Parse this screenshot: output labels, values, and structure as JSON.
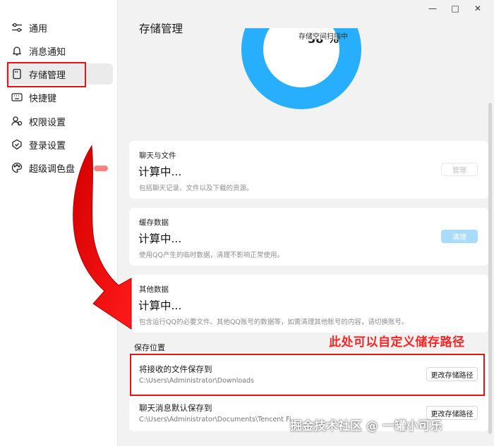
{
  "sidebar": {
    "items": [
      {
        "label": "通用",
        "icon": "sliders-icon"
      },
      {
        "label": "消息通知",
        "icon": "bell-icon"
      },
      {
        "label": "存储管理",
        "icon": "storage-icon",
        "active": true
      },
      {
        "label": "快捷键",
        "icon": "keyboard-icon"
      },
      {
        "label": "权限设置",
        "icon": "users-icon"
      },
      {
        "label": "登录设置",
        "icon": "shield-icon"
      },
      {
        "label": "超级调色盘",
        "icon": "palette-icon"
      }
    ]
  },
  "window": {
    "minimize": "—",
    "maximize": "□",
    "close": "✕"
  },
  "header": {
    "title": "存储管理"
  },
  "scan": {
    "percent": "38 %",
    "label": "存储空间扫描中",
    "ring_color": "#27aefc"
  },
  "cards": [
    {
      "label": "聊天与文件",
      "value": "计算中...",
      "desc": "包括聊天记录、文件以及下载的资源。",
      "button": "管理"
    },
    {
      "label": "缓存数据",
      "value": "计算中...",
      "desc": "使用QQ产生的临时数据，清理不影响正常使用。",
      "button": "清理"
    },
    {
      "label": "其他数据",
      "value": "计算中...",
      "desc": "包含运行QQ的必要文件、其他QQ账号的数据等，如需清理其他账号的内容，请切换账号。"
    }
  ],
  "save_location": {
    "title": "保存位置",
    "rows": [
      {
        "label": "将接收的文件保存到",
        "path": "C:\\Users\\Administrator\\Downloads",
        "button": "更改存储路径"
      },
      {
        "label": "聊天消息默认保存到",
        "path": "C:\\Users\\Administrator\\Documents\\Tencent Fi",
        "button": "更改存储路径"
      }
    ]
  },
  "annotation": {
    "text": "此处可以自定义储存路径",
    "color": "#ff2424"
  },
  "watermark": "掘金技术社区 @ 一罐小可乐"
}
